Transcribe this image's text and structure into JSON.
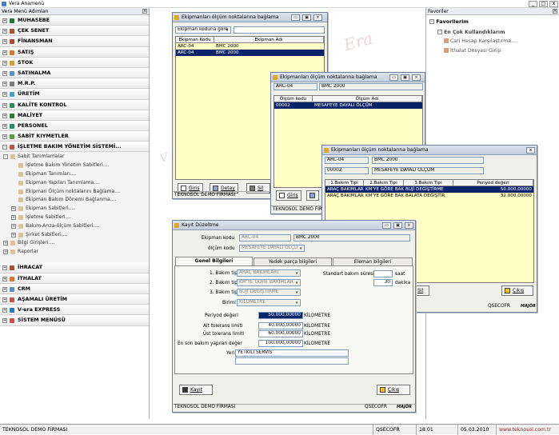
{
  "window": {
    "title": "Vera Anamenü"
  },
  "left_panel": {
    "title": "Vera Menü Adımları",
    "items": [
      {
        "label": "MUHASEBE",
        "color": "#1f7a3a",
        "expanded": false
      },
      {
        "label": "ÇEK SENET",
        "color": "#b04a3a",
        "expanded": false
      },
      {
        "label": "FİNANSMAN",
        "color": "#b04a3a",
        "expanded": false
      },
      {
        "label": "SATIŞ",
        "color": "#d07a30",
        "expanded": false
      },
      {
        "label": "STOK",
        "color": "#d0a030",
        "expanded": false
      },
      {
        "label": "SATINALMA",
        "color": "#5a8fc8",
        "expanded": false
      },
      {
        "label": "M.R.P.",
        "color": "#7a7a7a",
        "expanded": false
      },
      {
        "label": "ÜRETİM",
        "color": "#4a9fd0",
        "expanded": false
      },
      {
        "label": "KALİTE KONTROL",
        "color": "#2a8a5a",
        "expanded": false
      },
      {
        "label": "MALİYET",
        "color": "#2a7a3a",
        "expanded": false
      },
      {
        "label": "PERSONEL",
        "color": "#2a8a6a",
        "expanded": false
      },
      {
        "label": "SABİT KIYMETLER",
        "color": "#5a9a4a",
        "expanded": false
      },
      {
        "label": "İŞLETME BAKIM YÖNETİM SİSTEMİ...",
        "color": "#c85050",
        "expanded": true
      }
    ],
    "subitems": [
      {
        "label": "Sabit Tanımlamalar",
        "level": 1,
        "toggle": "-"
      },
      {
        "label": "İşletme Bakım Yönetim Sabitleri....",
        "level": 2,
        "toggle": ""
      },
      {
        "label": "Ekipman Tanımları....",
        "level": 2,
        "toggle": ""
      },
      {
        "label": "Ekipman Yapıları Tanımlama....",
        "level": 2,
        "toggle": ""
      },
      {
        "label": "Ekipman Ölçüm noktalarını Bağlama....",
        "level": 2,
        "toggle": ""
      },
      {
        "label": "Ekipman Bakım Dönemi Bağlanma....",
        "level": 2,
        "toggle": ""
      },
      {
        "label": "Ekipman Sabitleri....",
        "level": 2,
        "toggle": "+"
      },
      {
        "label": "İşletme Sabitleri....",
        "level": 2,
        "toggle": "+"
      },
      {
        "label": "Bakım-Arıza-ölçüm Sabitleri....",
        "level": 2,
        "toggle": "+"
      },
      {
        "label": "Şirket Sabitleri....",
        "level": 2,
        "toggle": "+"
      },
      {
        "label": "Bilgi Girişleri....",
        "level": 1,
        "toggle": "+"
      },
      {
        "label": "Raporlar",
        "level": 1,
        "toggle": "+"
      }
    ],
    "bottom_items": [
      {
        "label": "İHRACAT",
        "color": "#b04a3a"
      },
      {
        "label": "İTHALAT",
        "color": "#d07a30"
      },
      {
        "label": "CRM",
        "color": "#5a8fc8"
      },
      {
        "label": "AŞAMALI ÜRETİM",
        "color": "#c85050"
      },
      {
        "label": "V-era EXPRESS",
        "color": "#2a7ab0"
      },
      {
        "label": "SİSTEM MENÜSÜ",
        "color": "#c85050"
      }
    ]
  },
  "favorites": {
    "panel_title": "Favoriler",
    "heading": "Favorilerim",
    "group": "En Çok Kullandıklarım",
    "items": [
      "Cari Hesap Karşılaştırma....",
      "İthalat Dosyası Girişi"
    ]
  },
  "win1": {
    "title": "Ekipmanları ölçüm noktalarına bağlama",
    "filter_select": "Ekipman koduna göre",
    "filter_value": "",
    "columns": [
      "Ekipman Kodu",
      "Ekipman Adı"
    ],
    "rows": [
      [
        "ARC-04",
        "BMC 2000"
      ],
      [
        "ARC-04",
        "BMC 2000"
      ]
    ],
    "btn_new": "Giriş",
    "btn_edit": "Detay",
    "btn_del": "Sil",
    "status": "TEKNOSOL DEMO FİRMASI"
  },
  "win2": {
    "title": "Ekipmanları ölçüm noktalarına bağlama",
    "code": "ARC-04",
    "name": "BMC 2000",
    "columns": [
      "Ölçüm kodu",
      "Ölçüm Adı"
    ],
    "rows": [
      [
        "00002",
        "MESAFEYE DAYALI ÖLÇÜM"
      ]
    ],
    "btn_new": "Giriş",
    "status": "TEKNOSOL DEMO FİRMASI"
  },
  "win3": {
    "title": "Ekipmanları ölçüm noktalarına bağlama",
    "code": "ARC-04",
    "name": "BMC 2000",
    "m_code": "00002",
    "m_name": "MESAFEYE DAYALI ÖLÇÜM",
    "columns": [
      "1.Bakım Tipi",
      "2.Bakım Tipi",
      "3.Bakım Tipi",
      "Periyod değeri"
    ],
    "rows": [
      [
        "ARAÇ BAKIMLARI",
        "KM'YE GÖRE BAKIM",
        "BUJİ DEĞİŞTİRME",
        "50.000,00000"
      ],
      [
        "ARAÇ BAKIMLARI",
        "KM'YE GÖRE BAKIM",
        "BALATA DEĞİŞTİR",
        "32.000,00000"
      ]
    ],
    "btn_exit": "Çıkış",
    "btn_partial": "Sil",
    "status_user": "QSECOFR",
    "logo": "MAJÖR"
  },
  "dialog": {
    "title": "Kayıt Düzeltme",
    "ekipman_label": "Ekipman kodu",
    "ekipman_code": "ARC-04",
    "ekipman_name": "BMC 2000",
    "olcum_label": "ölçüm kodu",
    "olcum_value": "MESAFEYE DAYALI ÖLÇÜ",
    "tabs": [
      "Genel Bilgileri",
      "Yedek parça bilgileri",
      "Eleman bilgileri"
    ],
    "bakim1_label": "1. Bakım tipi",
    "bakim1": "ARAÇ BAKIMLARI",
    "bakim2_label": "2. Bakım tipi",
    "bakim2": "KM'YE GÖRE BAKIMLAR",
    "bakim3_label": "3. Bakım tipi",
    "bakim3": "BUJİ DEĞİŞTİRME",
    "birim_label": "Birimi",
    "birim": "KİLOMETRE",
    "standart_label": "Standart bakım süresi",
    "saat_value": "",
    "saat_label": "saat",
    "dakika_value": "30",
    "dakika_label": "dakika",
    "periyod_label": "Periyod değeri",
    "periyod": "50.000,00000",
    "periyod_unit": "KİLOMETRE",
    "alt_label": "Alt tolerans limiti",
    "alt": "40.000,00000",
    "alt_unit": "KİLOMETRE",
    "ust_label": "Üst tolerans limiti",
    "ust": "60.000,00000",
    "ust_unit": "KİLOMETRE",
    "son_label": "En son bakım yapılan değer",
    "son": "100.000,00000",
    "son_unit": "KİLOMETRE",
    "yeri_label": "Yeri",
    "yeri": "YETKİLİ SERVİS",
    "btn_save": "Kayıt",
    "btn_exit": "Çıkış",
    "status": "TEKNOSOL DEMO FİRMASI",
    "status_user": "QSECOFR",
    "logo": "MAJÖR"
  },
  "statusbar": {
    "company": "TEKNOSOL DEMO FİRMASI",
    "user": "QSECOFR",
    "time": "18:01",
    "date": "05.03.2010",
    "url": "www.teknosol.com.tr"
  },
  "watermark": "Era"
}
